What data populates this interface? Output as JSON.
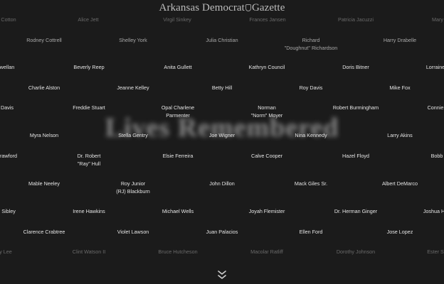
{
  "masthead": {
    "part1": "Arkansas Democrat",
    "part2": "Gazette"
  },
  "hero": {
    "title": "Lives Remembered"
  },
  "icons": {
    "emblem": "newspaper-emblem-icon",
    "scroll": "double-chevron-down-icon"
  },
  "names": {
    "r0": [
      "Cotton",
      "Alice Jett",
      "Virgil Sinkey",
      "Frances Jansen",
      "Patricia Jacuzzi",
      "Mary"
    ],
    "r1": [
      "Rodney Cottrell",
      "Shelley York",
      "Julia Christian",
      "Richard",
      "\"Doughnut\" Richardson",
      "Harry Drabelle"
    ],
    "r2": [
      "ewellan",
      "Beverly Reep",
      "Anita Gullett",
      "Kathryn Council",
      "Doris Bitner",
      "Lorraine"
    ],
    "r3": [
      "Charlie Alston",
      "Jeanne Kelley",
      "Betty Hill",
      "Roy Davis",
      "Mike Fox"
    ],
    "r4": [
      "Davis",
      "Freddie Stuart",
      "Opal Charlene",
      "Parmenter",
      "Norman",
      "\"Norm\" Moyer",
      "Robert Burmingham",
      "Connie"
    ],
    "r5": [
      "Myra Nelson",
      "Stella Gentry",
      "Joe Wigner",
      "Nina Kennedy",
      "Larry Akins"
    ],
    "r6": [
      "rawford",
      "Dr. Robert",
      "\"Ray\" Hull",
      "Elsie Ferreira",
      "Calve Cooper",
      "Hazel Floyd",
      "Bobb"
    ],
    "r7": [
      "Mable Neeley",
      "Roy Junior",
      "(RJ) Blackburn",
      "John Dillon",
      "Mack Giles Sr.",
      "Albert DeMarco"
    ],
    "r8": [
      "Sibley",
      "Irene Hawkins",
      "Michael Wells",
      "Joyah Flemister",
      "Dr. Herman Ginger",
      "Joshua H"
    ],
    "r9": [
      "Clarence Crabtree",
      "Violet Lawson",
      "Juan Palacios",
      "Ellen Ford",
      "Jose Lopez"
    ],
    "r10": [
      "y Lee",
      "Clint Watson II",
      "Bruce Hutcheson",
      "Macolar Ratliff",
      "Dorothy Johnson",
      "Ester S"
    ]
  }
}
